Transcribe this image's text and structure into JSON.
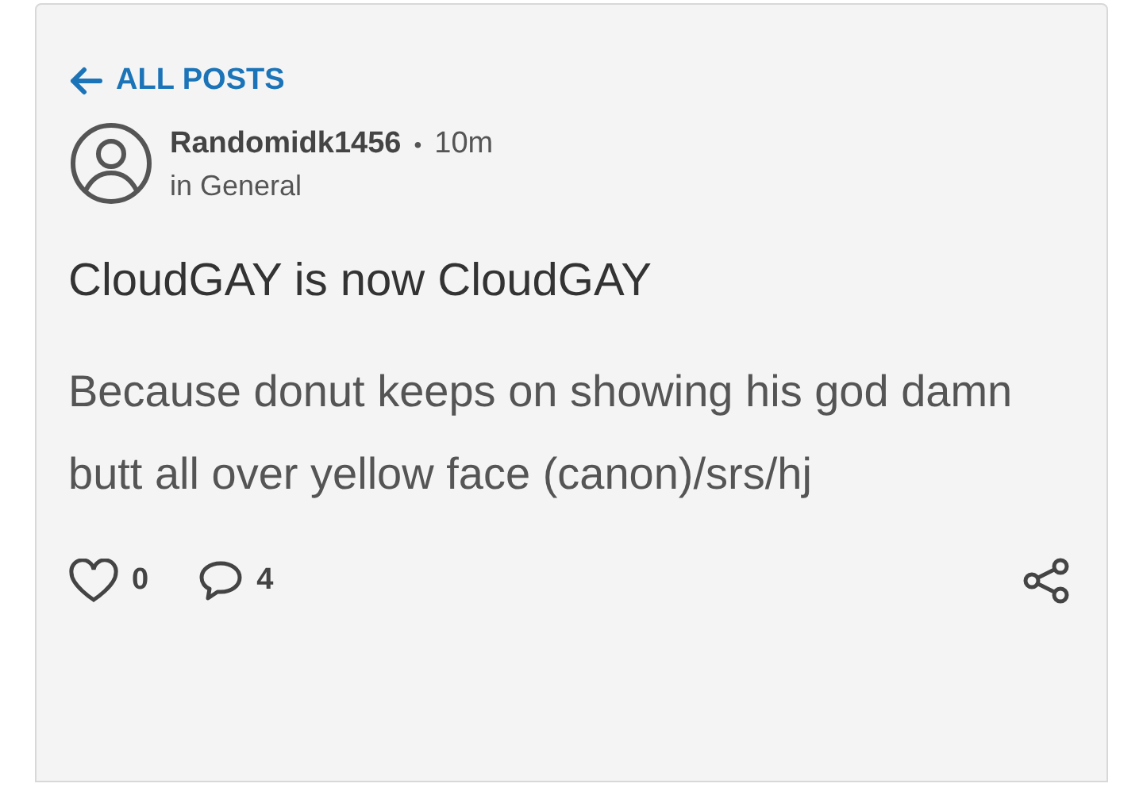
{
  "back_link": {
    "label": "ALL POSTS"
  },
  "post": {
    "author": "Randomidk1456",
    "separator": "•",
    "time": "10m",
    "category": "in General",
    "title": "CloudGAY is now CloudGAY",
    "body": "Because donut keeps on showing his god damn butt all over yellow face (canon)/srs/hj"
  },
  "actions": {
    "likes": "0",
    "comments": "4"
  }
}
